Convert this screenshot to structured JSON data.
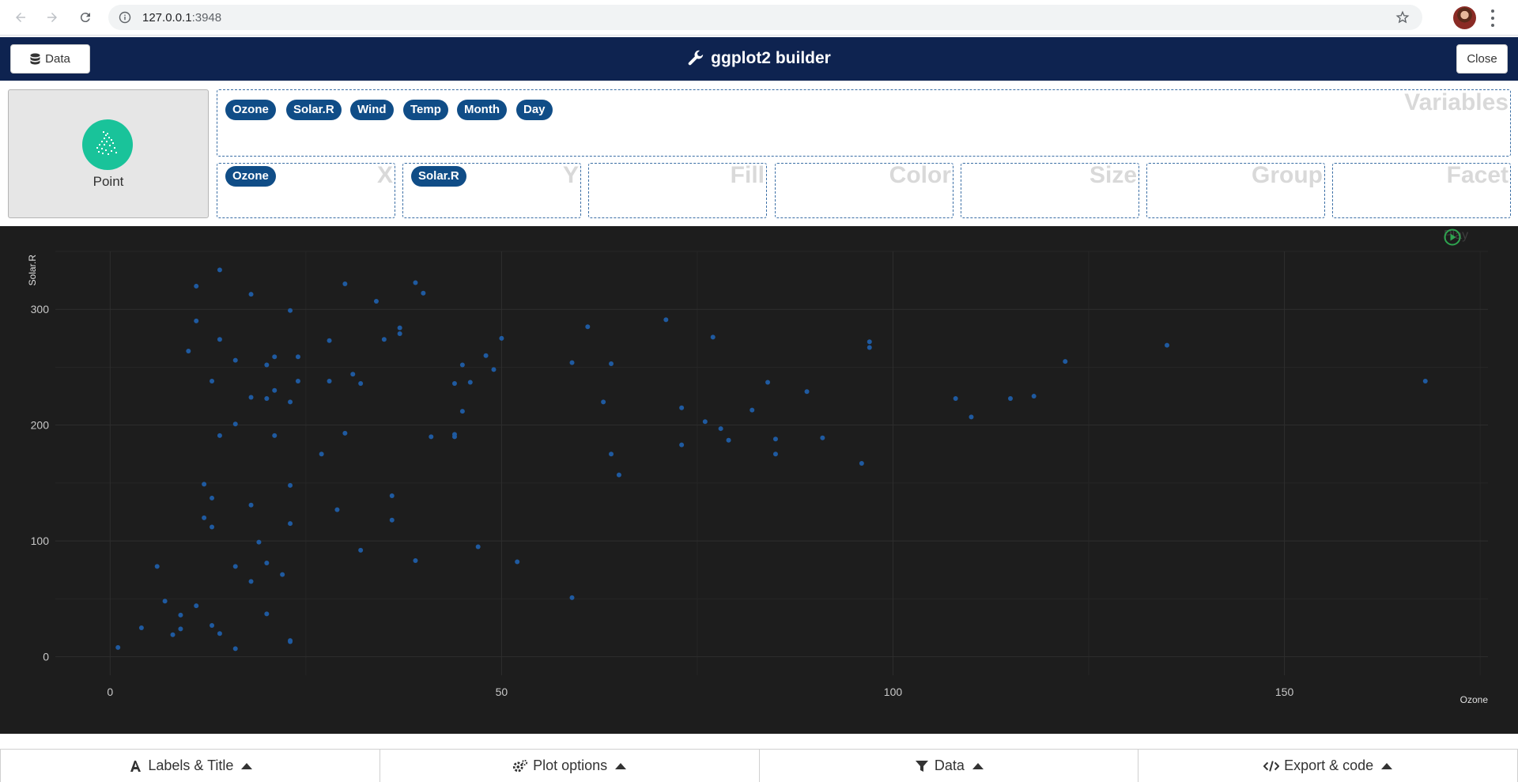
{
  "browser": {
    "url_host": "127.0.0.1",
    "url_port": ":3948"
  },
  "header": {
    "data_label": "Data",
    "title": "ggplot2 builder",
    "close_label": "Close"
  },
  "geom": {
    "label": "Point"
  },
  "zones": {
    "variables": {
      "title": "Variables",
      "items": [
        "Ozone",
        "Solar.R",
        "Wind",
        "Temp",
        "Month",
        "Day"
      ]
    },
    "x": {
      "title": "X",
      "items": [
        "Ozone"
      ]
    },
    "y": {
      "title": "Y",
      "items": [
        "Solar.R"
      ]
    },
    "fill": {
      "title": "Fill"
    },
    "color": {
      "title": "Color"
    },
    "size": {
      "title": "Size"
    },
    "group": {
      "title": "Group"
    },
    "facet": {
      "title": "Facet"
    }
  },
  "plot": {
    "play_label": "Play"
  },
  "chart_data": {
    "type": "scatter",
    "xlabel": "Ozone",
    "ylabel": "Solar.R",
    "xlim": [
      -7,
      176
    ],
    "ylim": [
      -16,
      350
    ],
    "xticks": [
      0,
      50,
      100,
      150
    ],
    "yticks": [
      0,
      100,
      200,
      300
    ],
    "grid": true,
    "point_color": "#1f5aa0",
    "background": "#1d1d1d",
    "points": [
      [
        1,
        8
      ],
      [
        4,
        25
      ],
      [
        6,
        78
      ],
      [
        7,
        48
      ],
      [
        8,
        19
      ],
      [
        9,
        24
      ],
      [
        9,
        36
      ],
      [
        10,
        264
      ],
      [
        11,
        320
      ],
      [
        11,
        290
      ],
      [
        11,
        44
      ],
      [
        12,
        120
      ],
      [
        12,
        149
      ],
      [
        13,
        238
      ],
      [
        13,
        137
      ],
      [
        13,
        112
      ],
      [
        13,
        27
      ],
      [
        14,
        334
      ],
      [
        14,
        274
      ],
      [
        14,
        191
      ],
      [
        14,
        20
      ],
      [
        16,
        256
      ],
      [
        16,
        201
      ],
      [
        16,
        78
      ],
      [
        16,
        7
      ],
      [
        18,
        313
      ],
      [
        18,
        224
      ],
      [
        18,
        131
      ],
      [
        18,
        65
      ],
      [
        19,
        99
      ],
      [
        20,
        252
      ],
      [
        20,
        223
      ],
      [
        20,
        81
      ],
      [
        20,
        37
      ],
      [
        21,
        259
      ],
      [
        21,
        230
      ],
      [
        21,
        191
      ],
      [
        22,
        71
      ],
      [
        23,
        299
      ],
      [
        23,
        220
      ],
      [
        23,
        148
      ],
      [
        23,
        115
      ],
      [
        23,
        14
      ],
      [
        23,
        13
      ],
      [
        24,
        259
      ],
      [
        24,
        238
      ],
      [
        27,
        175
      ],
      [
        28,
        273
      ],
      [
        28,
        238
      ],
      [
        29,
        127
      ],
      [
        30,
        322
      ],
      [
        30,
        193
      ],
      [
        31,
        244
      ],
      [
        32,
        236
      ],
      [
        32,
        92
      ],
      [
        34,
        307
      ],
      [
        35,
        274
      ],
      [
        36,
        139
      ],
      [
        36,
        118
      ],
      [
        37,
        284
      ],
      [
        37,
        279
      ],
      [
        39,
        323
      ],
      [
        39,
        83
      ],
      [
        40,
        314
      ],
      [
        41,
        190
      ],
      [
        44,
        236
      ],
      [
        44,
        192
      ],
      [
        44,
        190
      ],
      [
        45,
        252
      ],
      [
        45,
        212
      ],
      [
        46,
        237
      ],
      [
        47,
        95
      ],
      [
        48,
        260
      ],
      [
        49,
        248
      ],
      [
        50,
        275
      ],
      [
        52,
        82
      ],
      [
        59,
        254
      ],
      [
        59,
        51
      ],
      [
        61,
        285
      ],
      [
        63,
        220
      ],
      [
        64,
        253
      ],
      [
        64,
        175
      ],
      [
        65,
        157
      ],
      [
        71,
        291
      ],
      [
        73,
        215
      ],
      [
        73,
        183
      ],
      [
        76,
        203
      ],
      [
        77,
        276
      ],
      [
        78,
        197
      ],
      [
        79,
        187
      ],
      [
        82,
        213
      ],
      [
        84,
        237
      ],
      [
        85,
        188
      ],
      [
        85,
        175
      ],
      [
        89,
        229
      ],
      [
        91,
        189
      ],
      [
        96,
        167
      ],
      [
        97,
        272
      ],
      [
        97,
        267
      ],
      [
        108,
        223
      ],
      [
        110,
        207
      ],
      [
        115,
        223
      ],
      [
        118,
        225
      ],
      [
        122,
        255
      ],
      [
        135,
        269
      ],
      [
        168,
        238
      ]
    ]
  },
  "bottom_tabs": {
    "labels": "Labels & Title",
    "plot_options": "Plot options",
    "data": "Data",
    "export": "Export & code"
  }
}
